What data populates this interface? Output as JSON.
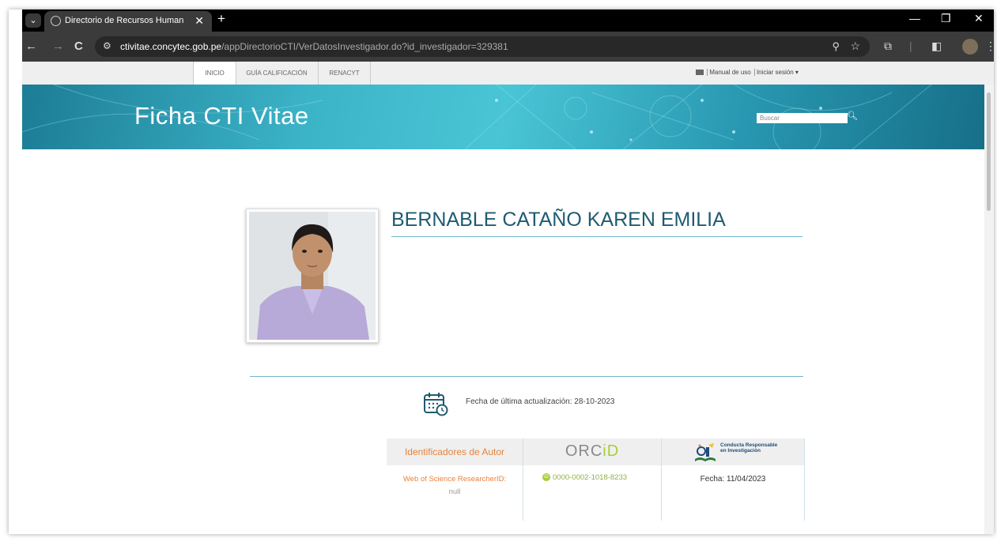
{
  "browser": {
    "tab_title": "Directorio de Recursos Humano",
    "tab_close": "✕",
    "new_tab": "+",
    "url_domain": "ctivitae.concytec.gob.pe",
    "url_path": "/appDirectorioCTI/VerDatosInvestigador.do?id_investigador=329381",
    "window_controls": [
      "—",
      "❐",
      "✕"
    ],
    "nav_buttons": [
      "←",
      "→",
      "C"
    ]
  },
  "site_nav": {
    "items": [
      "INICIO",
      "GUÍA CALIFICACIÓN",
      "RENACYT"
    ],
    "manual": "Manual de uso",
    "login": "Iniciar sesión ▾"
  },
  "banner": {
    "title": "Ficha CTI Vitae",
    "search_placeholder": "Buscar"
  },
  "profile": {
    "name": "BERNABLE CATAÑO KAREN EMILIA",
    "update_text": "Fecha de última actualización: 28-10-2023"
  },
  "identifiers": {
    "header": "Identificadores de Autor",
    "wos_label": "Web of Science ResearcherID:",
    "wos_value": "null",
    "orcid_logo_a": "ORC",
    "orcid_logo_b": "iD",
    "orcid_value": "0000-0002-1018-8233",
    "cr_logo_text": "Conducta Responsable en Investigación",
    "fecha": "Fecha: 11/04/2023"
  },
  "colors": {
    "accent": "#1e5b72",
    "orange": "#e8823a",
    "orcid_green": "#a6ce39"
  }
}
